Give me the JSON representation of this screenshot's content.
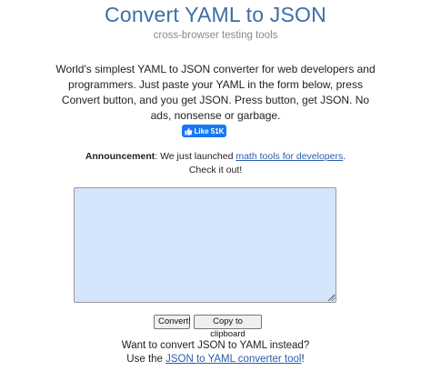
{
  "header": {
    "title": "Convert YAML to JSON",
    "subtitle": "cross-browser testing tools"
  },
  "intro": {
    "text": "World's simplest YAML to JSON converter for web developers and programmers. Just paste your YAML in the form below, press Convert button, and you get JSON. Press button, get JSON. No ads, nonsense or garbage."
  },
  "facebook": {
    "like_label": "Like 51K",
    "icon": "thumbs-up-icon",
    "color": "#1877f2"
  },
  "announcement": {
    "label": "Announcement",
    "text_before": ": We just launched ",
    "link_text": "math tools for developers",
    "text_after": ".",
    "line2": "Check it out!"
  },
  "editor": {
    "value": "",
    "background": "#d4e4fb"
  },
  "buttons": {
    "convert_label": "Convert!",
    "copy_label": "Copy to clipboard"
  },
  "footer": {
    "line1": "Want to convert JSON to YAML instead?",
    "line2_before": "Use the ",
    "link_text": "JSON to YAML converter tool",
    "line2_after": "!"
  },
  "colors": {
    "title": "#3c6ea8",
    "link": "#2a5db0"
  }
}
